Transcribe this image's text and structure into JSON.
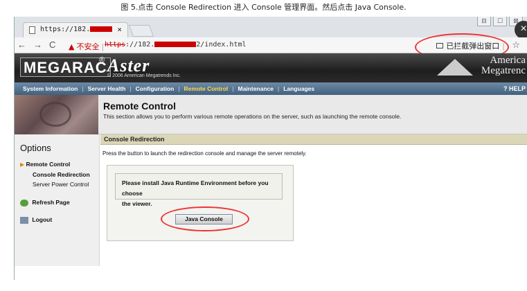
{
  "caption": "图 5.点击 Console Redirection  进入 Console 管理界面。然后点击 Java Console.",
  "browser": {
    "tab_title": "https://182.",
    "tab_close": "×",
    "url_scheme": "https",
    "url_host_prefix": "://182.",
    "url_path": "2/index.html",
    "security_warning": "不安全",
    "popup_blocked": "已拦截弹出窗口",
    "window_controls": [
      "⊟",
      "☐",
      "⊠"
    ]
  },
  "app": {
    "logo": "MEGARAC",
    "logo_mark": "®",
    "product": "Aster",
    "copyright": "© 2006 American Megatrends Inc.",
    "brand_line1": "America",
    "brand_line2": "Megatrenc"
  },
  "menu": {
    "items": [
      "System Information",
      "Server Health",
      "Configuration",
      "Remote Control",
      "Maintenance",
      "Languages"
    ],
    "separator": "|",
    "active": "Remote Control",
    "help": "HELP"
  },
  "banner": {
    "title": "Remote Control",
    "description": "This section allows you to perform various remote operations on the server, such as launching the remote console."
  },
  "sidebar": {
    "heading": "Options",
    "items": [
      "Remote Control",
      "Console Redirection",
      "Server Power Control",
      "Refresh Page",
      "Logout"
    ]
  },
  "main": {
    "section_title": "Console Redirection",
    "instruction": "Press the button to launch the redirection console and manage the server remotely.",
    "notice_line1": "Please install Java Runtime Environment before you choose",
    "notice_line2": "the viewer.",
    "button_label": "Java Console"
  },
  "colors": {
    "annotation_red": "#e33333",
    "menu_active": "#ffd84a",
    "section_header": "#dcd6b8"
  }
}
